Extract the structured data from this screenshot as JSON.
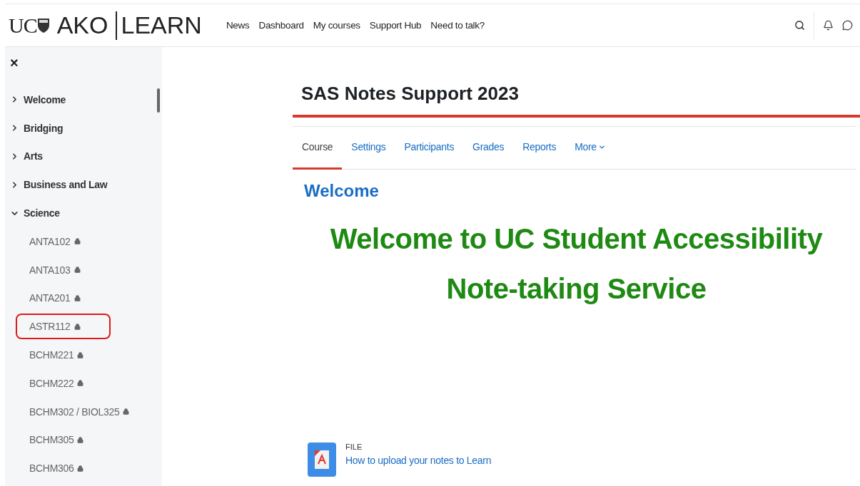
{
  "header": {
    "logo_left": "UC",
    "logo_brand": "AKO",
    "logo_product": "LEARN",
    "nav": [
      "News",
      "Dashboard",
      "My courses",
      "Support Hub",
      "Need to talk?"
    ]
  },
  "drawer": {
    "close": "×",
    "items": [
      {
        "kind": "section",
        "label": "Welcome",
        "expanded": false
      },
      {
        "kind": "section",
        "label": "Bridging",
        "expanded": false
      },
      {
        "kind": "section",
        "label": "Arts",
        "expanded": false
      },
      {
        "kind": "section",
        "label": "Business and Law",
        "expanded": false
      },
      {
        "kind": "section",
        "label": "Science",
        "expanded": true
      },
      {
        "kind": "course",
        "label": "ANTA102",
        "highlighted": false
      },
      {
        "kind": "course",
        "label": "ANTA103",
        "highlighted": false
      },
      {
        "kind": "course",
        "label": "ANTA201",
        "highlighted": false
      },
      {
        "kind": "course",
        "label": "ASTR112",
        "highlighted": true
      },
      {
        "kind": "course",
        "label": "BCHM221",
        "highlighted": false
      },
      {
        "kind": "course",
        "label": "BCHM222",
        "highlighted": false
      },
      {
        "kind": "course",
        "label": "BCHM302 / BIOL325",
        "highlighted": false
      },
      {
        "kind": "course",
        "label": "BCHM305",
        "highlighted": false
      },
      {
        "kind": "course",
        "label": "BCHM306",
        "highlighted": false
      }
    ]
  },
  "course": {
    "title": "SAS Notes Support 2023",
    "tabs": [
      {
        "label": "Course",
        "selected": true
      },
      {
        "label": "Settings",
        "selected": false
      },
      {
        "label": "Participants",
        "selected": false
      },
      {
        "label": "Grades",
        "selected": false
      },
      {
        "label": "Reports",
        "selected": false
      },
      {
        "label": "More",
        "selected": false,
        "dropdown": true
      }
    ],
    "section_title": "Welcome",
    "banner": [
      "Welcome to UC Student Accessibility",
      "Note-taking Service"
    ],
    "activity": {
      "type": "FILE",
      "name": "How to upload your notes to Learn"
    }
  }
}
